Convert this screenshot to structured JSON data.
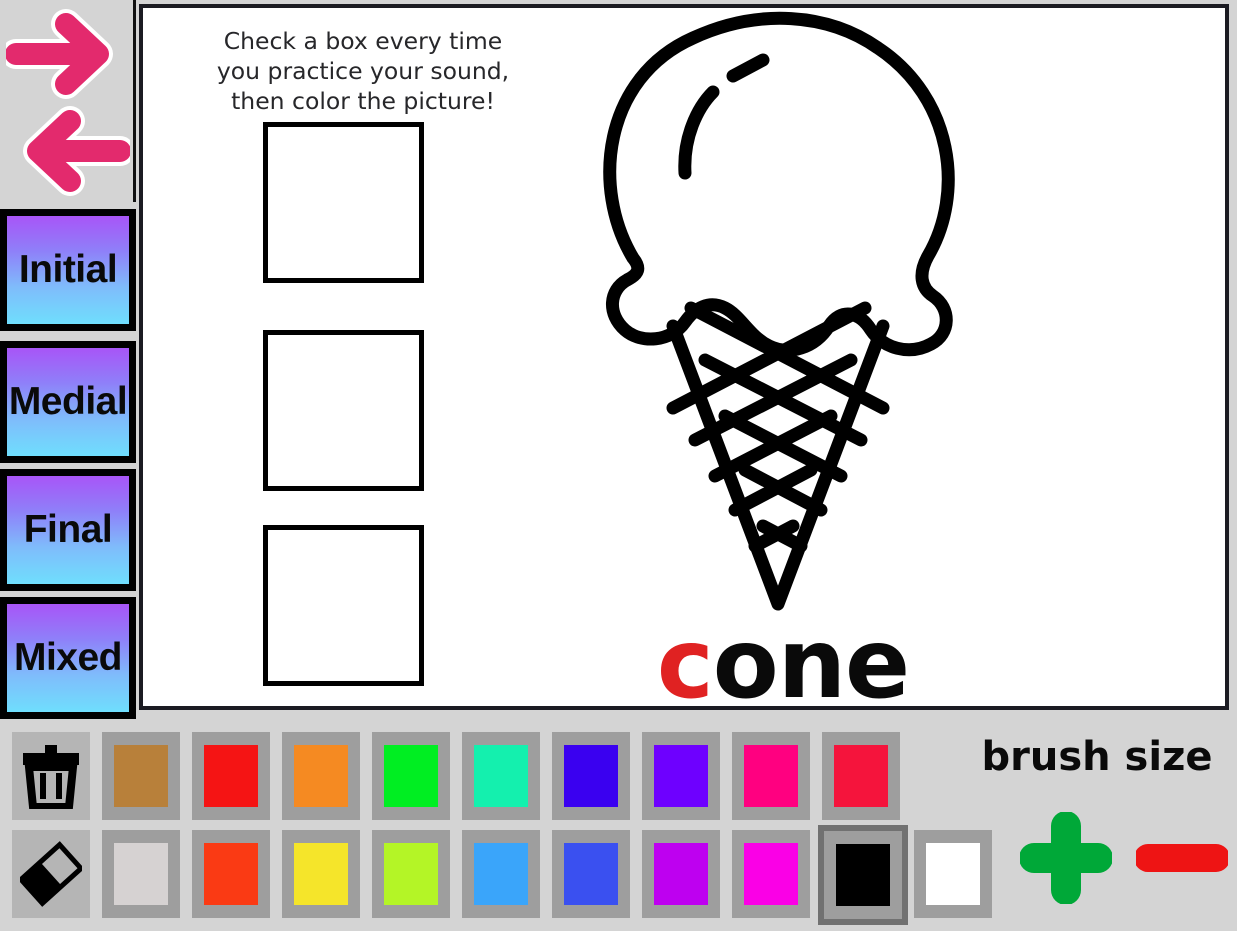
{
  "sidebar": {
    "nav": [
      {
        "name": "forward-arrow",
        "label": "Next page",
        "color": "#e32a6d"
      },
      {
        "name": "back-arrow",
        "label": "Previous page",
        "color": "#e32a6d"
      }
    ],
    "modes": [
      {
        "label": "Initial"
      },
      {
        "label": "Medial"
      },
      {
        "label": "Final"
      },
      {
        "label": "Mixed"
      }
    ],
    "mode_gradient_top": "#a855f7",
    "mode_gradient_bottom": "#6fdefd"
  },
  "canvas": {
    "instructions": [
      "Check a box every time",
      "you practice your sound,",
      "then color the picture!"
    ],
    "checkboxes": [
      {
        "checked": false
      },
      {
        "checked": false
      },
      {
        "checked": false
      }
    ],
    "picture": {
      "name": "ice-cream-cone",
      "line_color": "#000000",
      "fill_color": "#ffffff"
    },
    "word": {
      "first_letter": "c",
      "rest": "one",
      "full": "cone",
      "first_letter_color": "#e02222",
      "rest_color": "#0a0a0a"
    }
  },
  "toolbar": {
    "brush_size_label": "brush size",
    "brush_increase": {
      "label": "+",
      "color": "#00a838"
    },
    "brush_decrease": {
      "label": "−",
      "color": "#ee1414"
    },
    "tools": [
      {
        "name": "clear-canvas",
        "icon": "trash-icon",
        "label": "Clear"
      },
      {
        "name": "eraser",
        "icon": "eraser-icon",
        "label": "Eraser"
      }
    ],
    "selected_color": "#000000",
    "palette_row_1": [
      {
        "name": "brown",
        "hex": "#b8803a"
      },
      {
        "name": "red",
        "hex": "#f51414"
      },
      {
        "name": "orange",
        "hex": "#f58a22"
      },
      {
        "name": "green",
        "hex": "#00ee22"
      },
      {
        "name": "spring-green",
        "hex": "#14f0ae"
      },
      {
        "name": "blue-violet",
        "hex": "#3a00f0"
      },
      {
        "name": "purple",
        "hex": "#6e00ff"
      },
      {
        "name": "deep-pink",
        "hex": "#ff0080"
      },
      {
        "name": "crimson",
        "hex": "#f5143c"
      }
    ],
    "palette_row_2": [
      {
        "name": "light-gray",
        "hex": "#d6d2d2"
      },
      {
        "name": "orange-red",
        "hex": "#fa3a14"
      },
      {
        "name": "yellow",
        "hex": "#f5e52a"
      },
      {
        "name": "yellow-green",
        "hex": "#b4f526"
      },
      {
        "name": "sky-blue",
        "hex": "#3aa5fa"
      },
      {
        "name": "royal-blue",
        "hex": "#3a50f0"
      },
      {
        "name": "magenta-purple",
        "hex": "#be00f0"
      },
      {
        "name": "magenta",
        "hex": "#fa00e6"
      },
      {
        "name": "black",
        "hex": "#000000",
        "selected": true
      },
      {
        "name": "white",
        "hex": "#ffffff"
      }
    ]
  }
}
